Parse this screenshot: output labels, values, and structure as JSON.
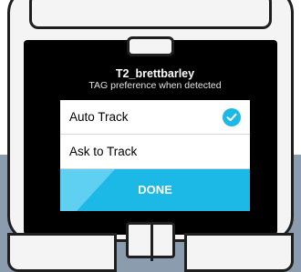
{
  "dialog": {
    "title": "T2_brettbarley",
    "subtitle": "TAG preference when detected",
    "options": [
      {
        "label": "Auto Track",
        "selected": true
      },
      {
        "label": "Ask to Track",
        "selected": false
      }
    ],
    "done_label": "DONE"
  },
  "colors": {
    "accent": "#1cb8e6",
    "screen": "#000000",
    "backdrop": "#8a9cad"
  },
  "icons": {
    "selected_indicator": "check-circle-icon"
  }
}
